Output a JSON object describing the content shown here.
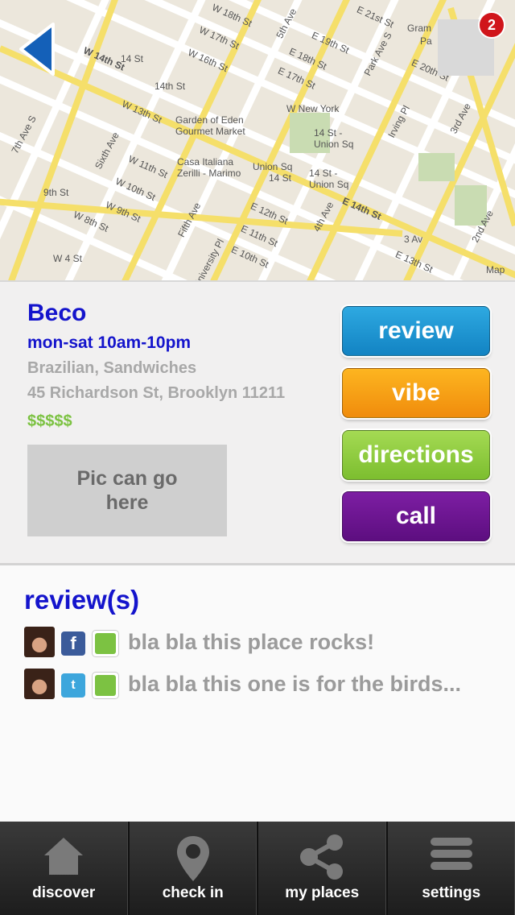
{
  "map": {
    "labels": [
      "W 14th St",
      "14 St",
      "14th St",
      "W 13th St",
      "W 18th St",
      "W 17th St",
      "W 16th St",
      "E 21st St",
      "E 19th St",
      "E 18th St",
      "E 17th St",
      "E 20th St",
      "Park Ave S",
      "5th Ave",
      "Sixth Ave",
      "7th Ave S",
      "Garden of Eden Gourmet Market",
      "W New York",
      "14 St - Union Sq",
      "Casa Italiana Zerilli - Marimo",
      "Union Sq",
      "14 St",
      "14 St - Union Sq",
      "W 11th St",
      "W 10th St",
      "W 9th St",
      "W 8th St",
      "9th St",
      "E 12th St",
      "E 11th St",
      "E 10th St",
      "E 14th St",
      "4th Ave",
      "3 Av",
      "E 13th St",
      "Fifth Ave",
      "Irving Pl",
      "3rd Ave",
      "2nd Ave",
      "W 4 St",
      "University Pl",
      "Gram",
      "Pa",
      "Map"
    ],
    "notification_count": "2"
  },
  "place": {
    "name": "Beco",
    "hours": "mon-sat 10am-10pm",
    "cuisine": "Brazilian, Sandwiches",
    "address": "45 Richardson St, Brooklyn 11211",
    "price": "$$$$$",
    "pic_placeholder": "Pic can go here"
  },
  "actions": {
    "review": "review",
    "vibe": "vibe",
    "directions": "directions",
    "call": "call"
  },
  "reviews": {
    "title": "review(s)",
    "items": [
      {
        "source": "facebook",
        "text": "bla bla this place rocks!"
      },
      {
        "source": "twitter",
        "text": "bla bla this one is for the birds..."
      }
    ]
  },
  "tabs": [
    {
      "label": "discover",
      "icon": "home-icon"
    },
    {
      "label": "check in",
      "icon": "location-pin-icon"
    },
    {
      "label": "my places",
      "icon": "share-icon"
    },
    {
      "label": "settings",
      "icon": "menu-icon"
    }
  ],
  "colors": {
    "accent_blue": "#1414cc",
    "review": "#1e96d2",
    "vibe": "#f7a01a",
    "directions": "#8ccb3e",
    "call": "#6a1590",
    "price_green": "#7cc242"
  }
}
